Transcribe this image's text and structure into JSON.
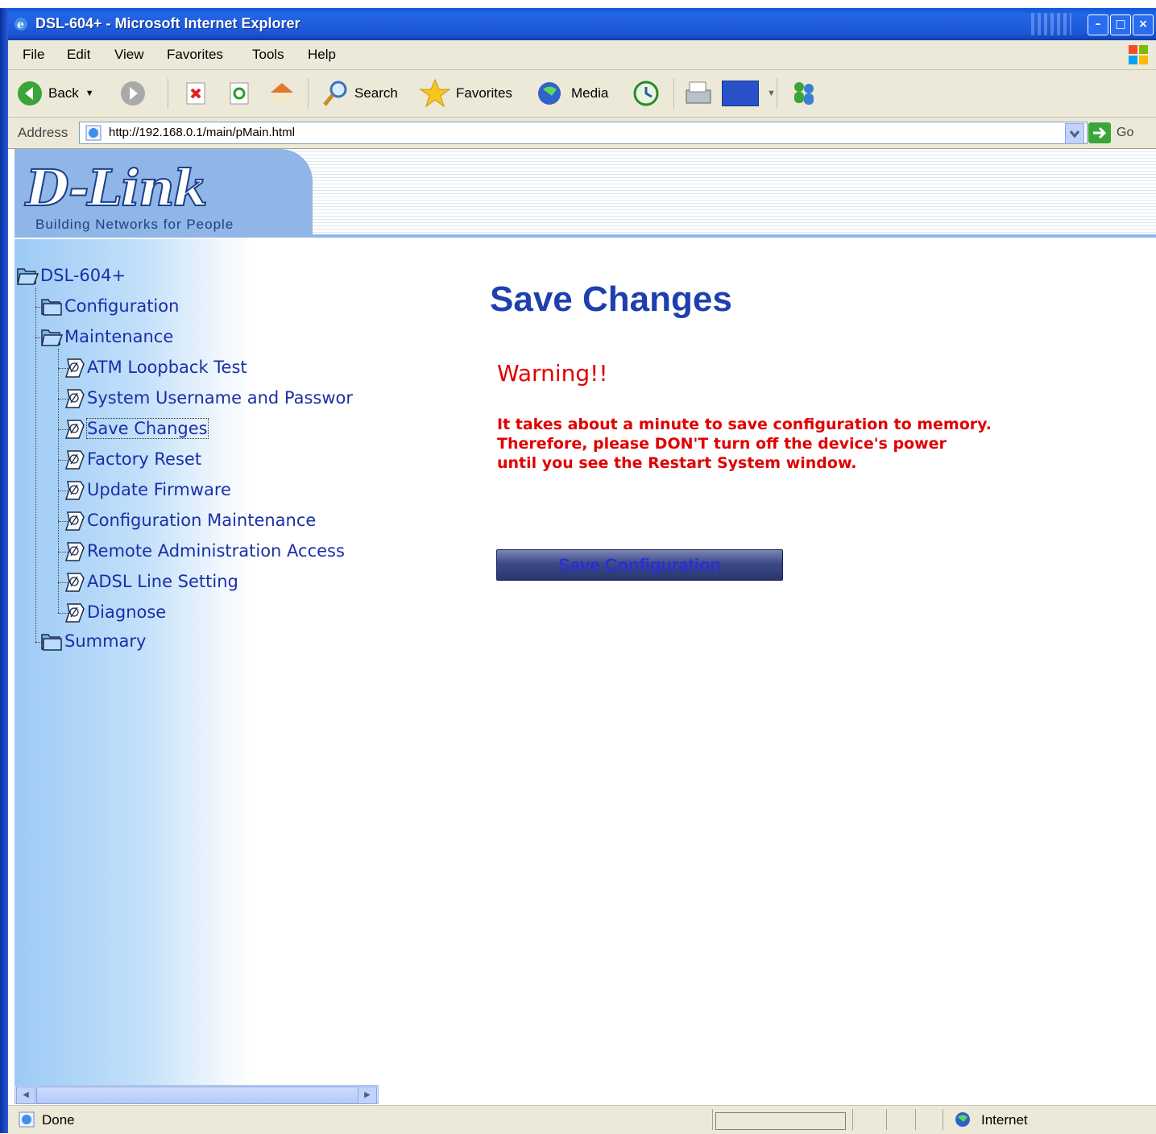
{
  "window": {
    "title": "DSL-604+ - Microsoft Internet Explorer"
  },
  "menu": [
    "File",
    "Edit",
    "View",
    "Favorites",
    "Tools",
    "Help"
  ],
  "toolbar": {
    "back": "Back",
    "search": "Search",
    "favorites": "Favorites",
    "media": "Media"
  },
  "address": {
    "label": "Address",
    "url": "http://192.168.0.1/main/pMain.html",
    "go": "Go"
  },
  "brand": {
    "logo": "D-Link",
    "tagline": "Building Networks for People"
  },
  "tree": {
    "root": "DSL-604+",
    "configuration": "Configuration",
    "maintenance": "Maintenance",
    "items": [
      "ATM Loopback Test",
      "System Username and Passwor",
      "Save Changes",
      "Factory Reset",
      "Update Firmware",
      "Configuration Maintenance",
      "Remote Administration Access",
      "ADSL Line Setting",
      "Diagnose"
    ],
    "summary": "Summary",
    "selected_index": 2
  },
  "content": {
    "heading": "Save Changes",
    "warning": "Warning!!",
    "message_lines": [
      "It takes about a minute to save configuration to memory.",
      "Therefore, please DON'T turn off the device's power",
      "until you see the Restart System window."
    ],
    "save_button": "Save Configuration"
  },
  "status": {
    "text": "Done",
    "zone": "Internet"
  },
  "colors": {
    "heading": "#1e3fae",
    "warning": "#e10000",
    "tree_text": "#1a2fa8",
    "titlebar": "#0a58d8"
  }
}
